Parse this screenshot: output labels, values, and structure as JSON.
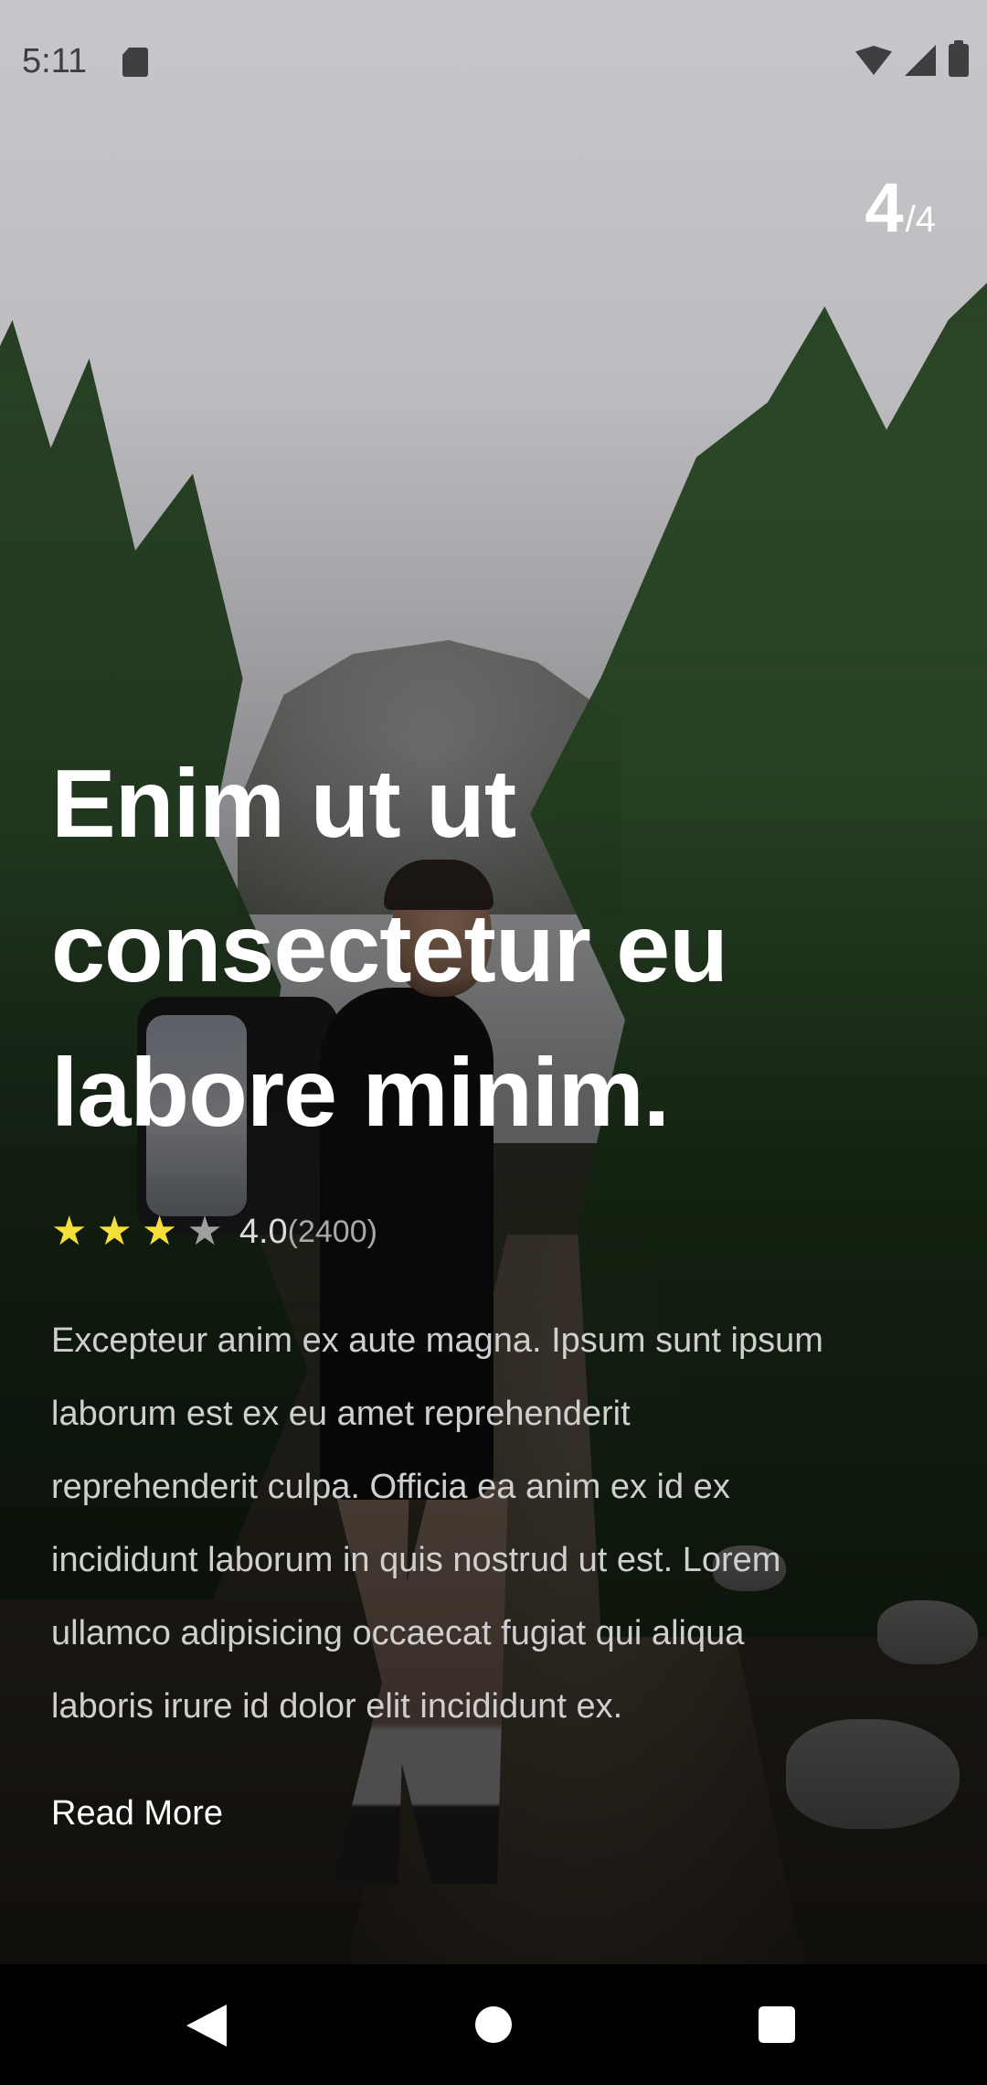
{
  "status_bar": {
    "time": "5:11",
    "icons": [
      "sd-card-icon",
      "wifi-icon",
      "cell-signal-icon",
      "battery-icon"
    ]
  },
  "pager": {
    "current": "4",
    "total": "/4"
  },
  "article": {
    "title": "Enim ut ut consectetur eu labore minim.",
    "rating": {
      "stars_filled": 3,
      "stars_total": 4,
      "value": "4.0",
      "count": "(2400)"
    },
    "description": "Excepteur anim ex aute magna. Ipsum sunt ipsum laborum est ex eu amet reprehenderit reprehenderit culpa. Officia ea anim ex id ex incididunt laborum in quis nostrud ut est. Lorem ullamco adipisicing occaecat fugiat qui aliqua laboris irure id dolor elit incididunt ex.",
    "read_more_label": "Read More"
  },
  "colors": {
    "star_filled": "#f5dd3a",
    "star_empty": "#9e9e9e",
    "text_primary": "#ffffff",
    "text_secondary": "#cfcfcf"
  },
  "nav_bar": {
    "icons": [
      "back-icon",
      "home-icon",
      "recents-icon"
    ]
  }
}
